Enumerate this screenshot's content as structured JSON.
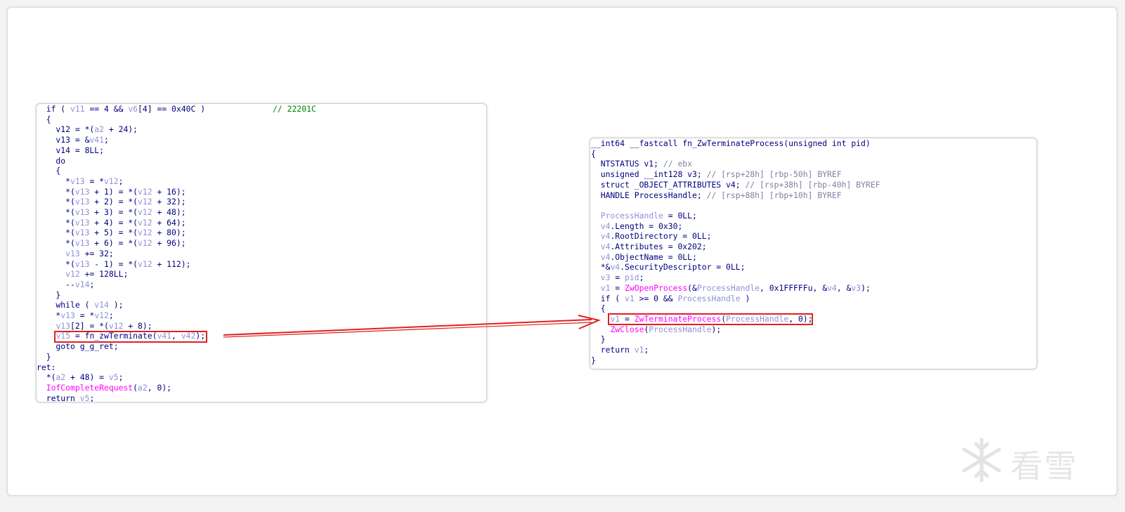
{
  "colors": {
    "plain": "#000080",
    "variable": "#9090d8",
    "comment": "#008000",
    "function": "#ff00ff",
    "gray": "#8080a0",
    "highlight": "#e02020"
  },
  "left_code": [
    [
      [
        "  if ( ",
        "p"
      ],
      [
        "v11",
        "v"
      ],
      [
        " == 4 && ",
        "p"
      ],
      [
        "v6",
        "v"
      ],
      [
        "[4] == 0x40C )              ",
        "p"
      ],
      [
        "// 22201C",
        "c"
      ]
    ],
    [
      [
        "  {",
        "p"
      ]
    ],
    [
      [
        "    v12 = *(",
        "p"
      ],
      [
        "a2",
        "v"
      ],
      [
        " + 24);",
        "p"
      ]
    ],
    [
      [
        "    v13 = &",
        "p"
      ],
      [
        "v41",
        "v"
      ],
      [
        ";",
        "p"
      ]
    ],
    [
      [
        "    v14 = 8LL;",
        "p"
      ]
    ],
    [
      [
        "    do",
        "p"
      ]
    ],
    [
      [
        "    {",
        "p"
      ]
    ],
    [
      [
        "      *",
        "p"
      ],
      [
        "v13",
        "v"
      ],
      [
        " = *",
        "p"
      ],
      [
        "v12",
        "v"
      ],
      [
        ";",
        "p"
      ]
    ],
    [
      [
        "      *(",
        "p"
      ],
      [
        "v13",
        "v"
      ],
      [
        " + 1) = *(",
        "p"
      ],
      [
        "v12",
        "v"
      ],
      [
        " + 16);",
        "p"
      ]
    ],
    [
      [
        "      *(",
        "p"
      ],
      [
        "v13",
        "v"
      ],
      [
        " + 2) = *(",
        "p"
      ],
      [
        "v12",
        "v"
      ],
      [
        " + 32);",
        "p"
      ]
    ],
    [
      [
        "      *(",
        "p"
      ],
      [
        "v13",
        "v"
      ],
      [
        " + 3) = *(",
        "p"
      ],
      [
        "v12",
        "v"
      ],
      [
        " + 48);",
        "p"
      ]
    ],
    [
      [
        "      *(",
        "p"
      ],
      [
        "v13",
        "v"
      ],
      [
        " + 4) = *(",
        "p"
      ],
      [
        "v12",
        "v"
      ],
      [
        " + 64);",
        "p"
      ]
    ],
    [
      [
        "      *(",
        "p"
      ],
      [
        "v13",
        "v"
      ],
      [
        " + 5) = *(",
        "p"
      ],
      [
        "v12",
        "v"
      ],
      [
        " + 80);",
        "p"
      ]
    ],
    [
      [
        "      *(",
        "p"
      ],
      [
        "v13",
        "v"
      ],
      [
        " + 6) = *(",
        "p"
      ],
      [
        "v12",
        "v"
      ],
      [
        " + 96);",
        "p"
      ]
    ],
    [
      [
        "      ",
        "p"
      ],
      [
        "v13",
        "v"
      ],
      [
        " += 32;",
        "p"
      ]
    ],
    [
      [
        "      *(",
        "p"
      ],
      [
        "v13",
        "v"
      ],
      [
        " - 1) = *(",
        "p"
      ],
      [
        "v12",
        "v"
      ],
      [
        " + 112);",
        "p"
      ]
    ],
    [
      [
        "      ",
        "p"
      ],
      [
        "v12",
        "v"
      ],
      [
        " += 128LL;",
        "p"
      ]
    ],
    [
      [
        "      --",
        "p"
      ],
      [
        "v14",
        "v"
      ],
      [
        ";",
        "p"
      ]
    ],
    [
      [
        "    }",
        "p"
      ]
    ],
    [
      [
        "    while ( ",
        "p"
      ],
      [
        "v14",
        "v"
      ],
      [
        " );",
        "p"
      ]
    ],
    [
      [
        "    *",
        "p"
      ],
      [
        "v13",
        "v"
      ],
      [
        " = *",
        "p"
      ],
      [
        "v12",
        "v"
      ],
      [
        ";",
        "p"
      ]
    ],
    [
      [
        "    ",
        "p"
      ],
      [
        "v13",
        "v"
      ],
      [
        "[2] = *(",
        "p"
      ],
      [
        "v12",
        "v"
      ],
      [
        " + 8);",
        "p"
      ]
    ],
    [
      [
        "    ",
        "p"
      ],
      [
        "v15",
        "v"
      ],
      [
        " = fn_zwTerminate(",
        "p"
      ],
      [
        "v41",
        "v"
      ],
      [
        ", ",
        "p"
      ],
      [
        "v42",
        "v"
      ],
      [
        ");",
        "p"
      ]
    ],
    [
      [
        "    goto g_g_ret;",
        "p"
      ]
    ],
    [
      [
        "  }",
        "p"
      ]
    ],
    [
      [
        "ret:",
        "p"
      ]
    ],
    [
      [
        "  *(",
        "p"
      ],
      [
        "a2",
        "v"
      ],
      [
        " + 48) = ",
        "p"
      ],
      [
        "v5",
        "v"
      ],
      [
        ";",
        "p"
      ]
    ],
    [
      [
        "  ",
        "p"
      ],
      [
        "IofCompleteRequest",
        "f"
      ],
      [
        "(",
        "p"
      ],
      [
        "a2",
        "v"
      ],
      [
        ", 0);",
        "p"
      ]
    ],
    [
      [
        "  return ",
        "p"
      ],
      [
        "v5",
        "v"
      ],
      [
        ";",
        "p"
      ]
    ]
  ],
  "right_code": [
    [
      [
        "__int64 __fastcall fn_ZwTerminateProcess(unsigned int pid)",
        "p"
      ]
    ],
    [
      [
        "{",
        "p"
      ]
    ],
    [
      [
        "  NTSTATUS v1; ",
        "p"
      ],
      [
        "// ebx",
        "g"
      ]
    ],
    [
      [
        "  unsigned __int128 v3; ",
        "p"
      ],
      [
        "// [rsp+28h] [rbp-50h] BYREF",
        "g"
      ]
    ],
    [
      [
        "  struct _OBJECT_ATTRIBUTES v4; ",
        "p"
      ],
      [
        "// [rsp+38h] [rbp-40h] BYREF",
        "g"
      ]
    ],
    [
      [
        "  HANDLE ProcessHandle; ",
        "p"
      ],
      [
        "// [rsp+88h] [rbp+10h] BYREF",
        "g"
      ]
    ],
    [
      [
        "",
        "p"
      ]
    ],
    [
      [
        "  ",
        "p"
      ],
      [
        "ProcessHandle",
        "v"
      ],
      [
        " = 0LL;",
        "p"
      ]
    ],
    [
      [
        "  ",
        "p"
      ],
      [
        "v4",
        "v"
      ],
      [
        ".Length = 0x30;",
        "p"
      ]
    ],
    [
      [
        "  ",
        "p"
      ],
      [
        "v4",
        "v"
      ],
      [
        ".RootDirectory = 0LL;",
        "p"
      ]
    ],
    [
      [
        "  ",
        "p"
      ],
      [
        "v4",
        "v"
      ],
      [
        ".Attributes = 0x202;",
        "p"
      ]
    ],
    [
      [
        "  ",
        "p"
      ],
      [
        "v4",
        "v"
      ],
      [
        ".ObjectName = 0LL;",
        "p"
      ]
    ],
    [
      [
        "  *&",
        "p"
      ],
      [
        "v4",
        "v"
      ],
      [
        ".SecurityDescriptor = 0LL;",
        "p"
      ]
    ],
    [
      [
        "  ",
        "p"
      ],
      [
        "v3",
        "v"
      ],
      [
        " = ",
        "p"
      ],
      [
        "pid",
        "v"
      ],
      [
        ";",
        "p"
      ]
    ],
    [
      [
        "  ",
        "p"
      ],
      [
        "v1",
        "v"
      ],
      [
        " = ",
        "p"
      ],
      [
        "ZwOpenProcess",
        "f"
      ],
      [
        "(&",
        "p"
      ],
      [
        "ProcessHandle",
        "v"
      ],
      [
        ", 0x1FFFFFu, &",
        "p"
      ],
      [
        "v4",
        "v"
      ],
      [
        ", &",
        "p"
      ],
      [
        "v3",
        "v"
      ],
      [
        ");",
        "p"
      ]
    ],
    [
      [
        "  if ( ",
        "p"
      ],
      [
        "v1",
        "v"
      ],
      [
        " >= 0 && ",
        "p"
      ],
      [
        "ProcessHandle",
        "v"
      ],
      [
        " )",
        "p"
      ]
    ],
    [
      [
        "  {",
        "p"
      ]
    ],
    [
      [
        "    ",
        "p"
      ],
      [
        "v1",
        "v"
      ],
      [
        " = ",
        "p"
      ],
      [
        "ZwTerminateProcess",
        "f"
      ],
      [
        "(",
        "p"
      ],
      [
        "ProcessHandle",
        "v"
      ],
      [
        ", 0);",
        "p"
      ]
    ],
    [
      [
        "    ",
        "p"
      ],
      [
        "ZwClose",
        "f"
      ],
      [
        "(",
        "p"
      ],
      [
        "ProcessHandle",
        "v"
      ],
      [
        ");",
        "p"
      ]
    ],
    [
      [
        "  }",
        "p"
      ]
    ],
    [
      [
        "  return ",
        "p"
      ],
      [
        "v1",
        "v"
      ],
      [
        ";",
        "p"
      ]
    ],
    [
      [
        "}",
        "p"
      ]
    ]
  ],
  "watermark": {
    "icon": "snowflake-icon",
    "text": "看雪"
  }
}
